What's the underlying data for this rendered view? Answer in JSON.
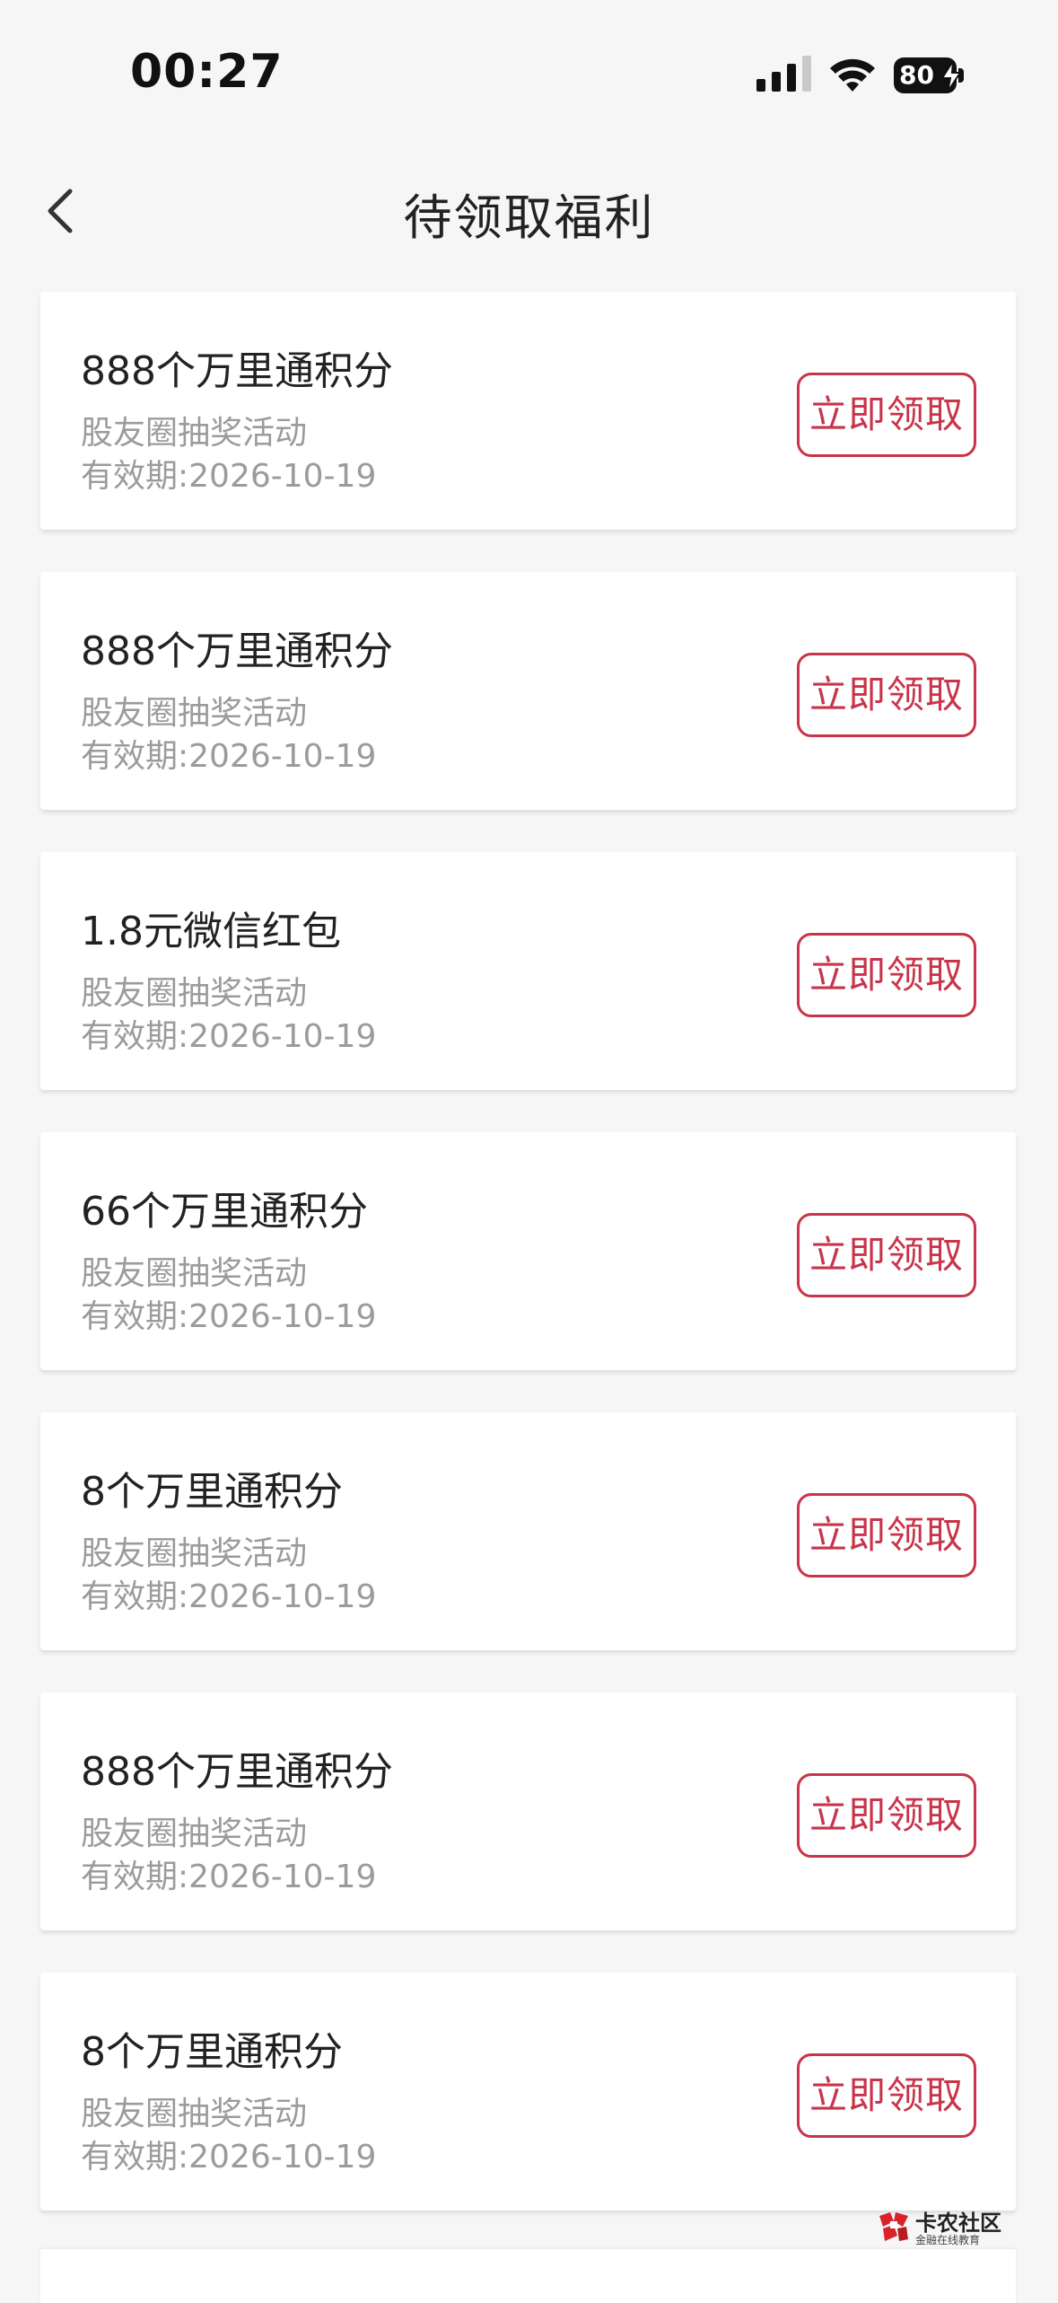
{
  "status_bar": {
    "time": "00:27",
    "battery": "80",
    "icons": [
      "signal-icon",
      "wifi-icon",
      "battery-icon",
      "charging-bolt-icon"
    ]
  },
  "header": {
    "back_icon": "chevron-left-icon",
    "title": "待领取福利"
  },
  "colors": {
    "accent": "#c8344a",
    "background": "#f6f6f6",
    "card": "#ffffff",
    "secondary_text": "#9b9b9b"
  },
  "rewards": [
    {
      "title": "888个万里通积分",
      "source": "股友圈抽奖活动",
      "expiry": "有效期:2026-10-19",
      "button": "立即领取"
    },
    {
      "title": "888个万里通积分",
      "source": "股友圈抽奖活动",
      "expiry": "有效期:2026-10-19",
      "button": "立即领取"
    },
    {
      "title": "1.8元微信红包",
      "source": "股友圈抽奖活动",
      "expiry": "有效期:2026-10-19",
      "button": "立即领取"
    },
    {
      "title": "66个万里通积分",
      "source": "股友圈抽奖活动",
      "expiry": "有效期:2026-10-19",
      "button": "立即领取"
    },
    {
      "title": "8个万里通积分",
      "source": "股友圈抽奖活动",
      "expiry": "有效期:2026-10-19",
      "button": "立即领取"
    },
    {
      "title": "888个万里通积分",
      "source": "股友圈抽奖活动",
      "expiry": "有效期:2026-10-19",
      "button": "立即领取"
    },
    {
      "title": "8个万里通积分",
      "source": "股友圈抽奖活动",
      "expiry": "有效期:2026-10-19",
      "button": "立即领取"
    }
  ],
  "watermark": {
    "name": "卡农社区",
    "tagline": "金融在线教育"
  }
}
